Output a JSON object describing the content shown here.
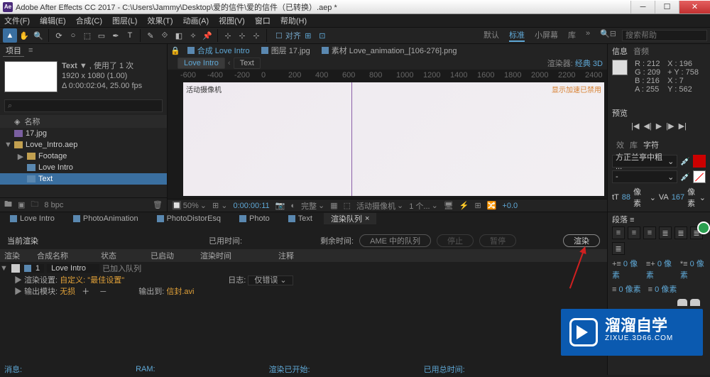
{
  "title_bar": {
    "title": "Adobe After Effects CC 2017 - C:\\Users\\Jammy\\Desktop\\爱的信件\\爱的信件（已转换）.aep *"
  },
  "menu": [
    "文件(F)",
    "编辑(E)",
    "合成(C)",
    "图层(L)",
    "效果(T)",
    "动画(A)",
    "视图(V)",
    "窗口",
    "帮助(H)"
  ],
  "toolbar": {
    "snap": "对齐"
  },
  "workspaces": {
    "items": [
      "默认",
      "标准",
      "小屏幕",
      "库"
    ],
    "active": 1,
    "search_placeholder": "搜索帮助"
  },
  "project": {
    "tab": "项目",
    "name": "Text",
    "usage": "使用了 1 次",
    "size": "1920 x 1080 (1.00)",
    "dur": "Δ 0:00:02:04, 25.00 fps",
    "col_name": "名称",
    "tree": [
      {
        "indent": 0,
        "icon": "img",
        "label": "17.jpg",
        "tw": ""
      },
      {
        "indent": 0,
        "icon": "folder",
        "label": "Love_Intro.aep",
        "tw": "▼"
      },
      {
        "indent": 1,
        "icon": "folder",
        "label": "Footage",
        "tw": "▶"
      },
      {
        "indent": 1,
        "icon": "comp",
        "label": "Love Intro",
        "tw": "",
        "sel": false
      },
      {
        "indent": 1,
        "icon": "comp",
        "label": "Text",
        "tw": "",
        "sel": true
      }
    ],
    "footer_bpc": "8 bpc"
  },
  "viewer": {
    "tabs": [
      {
        "label": "合成 Love Intro",
        "active": true
      },
      {
        "label": "图层 17.jpg"
      },
      {
        "label": "素材 Love_animation_[106-276].png"
      }
    ],
    "subtabs": [
      {
        "label": "Love Intro",
        "active": true
      },
      {
        "label": "Text"
      }
    ],
    "renderer_label": "渲染器:",
    "renderer_value": "经典 3D",
    "ruler_ticks": [
      "-600",
      "-400",
      "-200",
      "0",
      "200",
      "400",
      "600",
      "800",
      "1000",
      "1200",
      "1400",
      "1600",
      "1800",
      "2000",
      "2200",
      "2400"
    ],
    "camera": "活动摄像机",
    "gpu": "显示加速已禁用",
    "footer": {
      "zoom": "50%",
      "time": "0:00:00:11",
      "res": "完整",
      "cam": "活动摄像机",
      "views": "1 个...",
      "exposure": "+0.0"
    }
  },
  "info": {
    "tab_info": "信息",
    "tab_audio": "音频",
    "r": "R : 212",
    "g": "G : 209",
    "b": "B : 216",
    "a": "A : 255",
    "x": "X : 196",
    "yv": "+ Y : 758",
    "xy": "X : 7",
    "y2": "Y : 562"
  },
  "preview": {
    "tab": "预览"
  },
  "char": {
    "tabs": [
      "效",
      "库",
      "字符"
    ],
    "font": "方正兰亭中粗 ...",
    "tt": "tT",
    "size": "88",
    "size_unit": "像素",
    "va": "VA",
    "va_val": "167",
    "va_unit": "像素"
  },
  "timeline": {
    "tabs": [
      {
        "label": "Love Intro"
      },
      {
        "label": "PhotoAnimation"
      },
      {
        "label": "PhotoDistorEsq"
      },
      {
        "label": "Photo"
      },
      {
        "label": "Text"
      },
      {
        "label": "渲染队列",
        "plain": true,
        "active": true
      }
    ],
    "current": "当前渲染",
    "elapsed": "已用时间:",
    "remaining": "剩余时间:",
    "btn_ame": "AME 中的队列",
    "btn_stop": "停止",
    "btn_pause": "暂停",
    "btn_render": "渲染",
    "cols": {
      "render": "渲染",
      "comp": "合成名称",
      "status": "状态",
      "started": "已启动",
      "rtime": "渲染时间",
      "notes": "注释"
    },
    "item": {
      "num": "1",
      "name": "Love Intro",
      "status": "已加入队列"
    },
    "settings_label": "渲染设置:",
    "settings_val": "自定义: \"最佳设置\"",
    "log_label": "日志:",
    "log_val": "仅错误",
    "output_module": "输出模块:",
    "output_module_val": "无损",
    "output_to": "输出到:",
    "output_to_val": "信封.avi",
    "status_row": {
      "msg": "消息:",
      "ram": "RAM:",
      "started": "渲染已开始:",
      "total": "已用总时间:"
    }
  },
  "paragraph": {
    "tab": "段落",
    "v1": "0 像素",
    "v2": "0 像素",
    "v3": "0 像素",
    "v4": "0 像素",
    "v5": "0 像素"
  },
  "watermark": {
    "big": "溜溜自学",
    "sm": "ZIXUE.3D66.COM"
  }
}
